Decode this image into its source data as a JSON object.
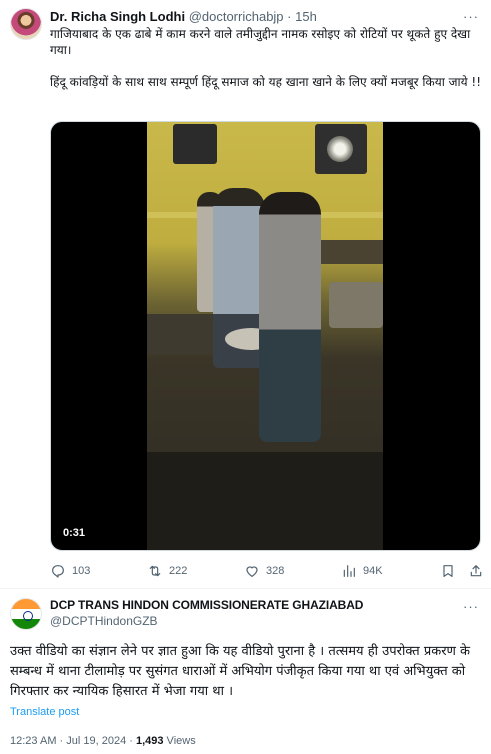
{
  "original_post": {
    "author_name": "Dr. Richa Singh Lodhi",
    "author_handle": "@doctorrichabjp",
    "separator": "·",
    "time": "15h",
    "text_line1": "गाजियाबाद के एक ढाबे में काम करने वाले तमीजुद्दीन नामक रसोइए को रोटियों पर थूकते हुए देखा गया।",
    "text_line2": "हिंदू कांवड़ियों के साथ साथ सम्पूर्ण हिंदू समाज को यह खाना खाने के लिए क्यों मजबूर किया जाये !!",
    "video_duration": "0:31",
    "replies": "103",
    "reposts": "222",
    "likes": "328",
    "views": "94K",
    "more": "···"
  },
  "reply_post": {
    "author_name": "DCP TRANS HINDON COMMISSIONERATE GHAZIABAD",
    "author_handle": "@DCPTHindonGZB",
    "more": "···",
    "text": "उक्त वीडियो का संज्ञान लेने पर ज्ञात हुआ कि यह वीडियो पुराना है । तत्समय ही उपरोक्त प्रकरण के सम्बन्ध में थाना टीलामोड़ पर सुसंगत धाराओं में अभियोग पंजीकृत किया गया था एवं अभियुक्त को गिरफ्तार कर न्यायिक हिसारत में भेजा गया था ।",
    "translate_label": "Translate post",
    "timestamp": "12:23 AM · Jul 19, 2024 · ",
    "views_count": "1,493",
    "views_label": " Views"
  },
  "icons": {
    "reply": "reply-icon",
    "repost": "repost-icon",
    "like": "heart-icon",
    "views": "analytics-icon",
    "bookmark": "bookmark-icon",
    "share": "share-icon",
    "more": "more-icon"
  },
  "colors": {
    "text": "#0f1419",
    "secondary": "#536471",
    "link": "#1d9bf0",
    "border": "#eff3f4"
  }
}
